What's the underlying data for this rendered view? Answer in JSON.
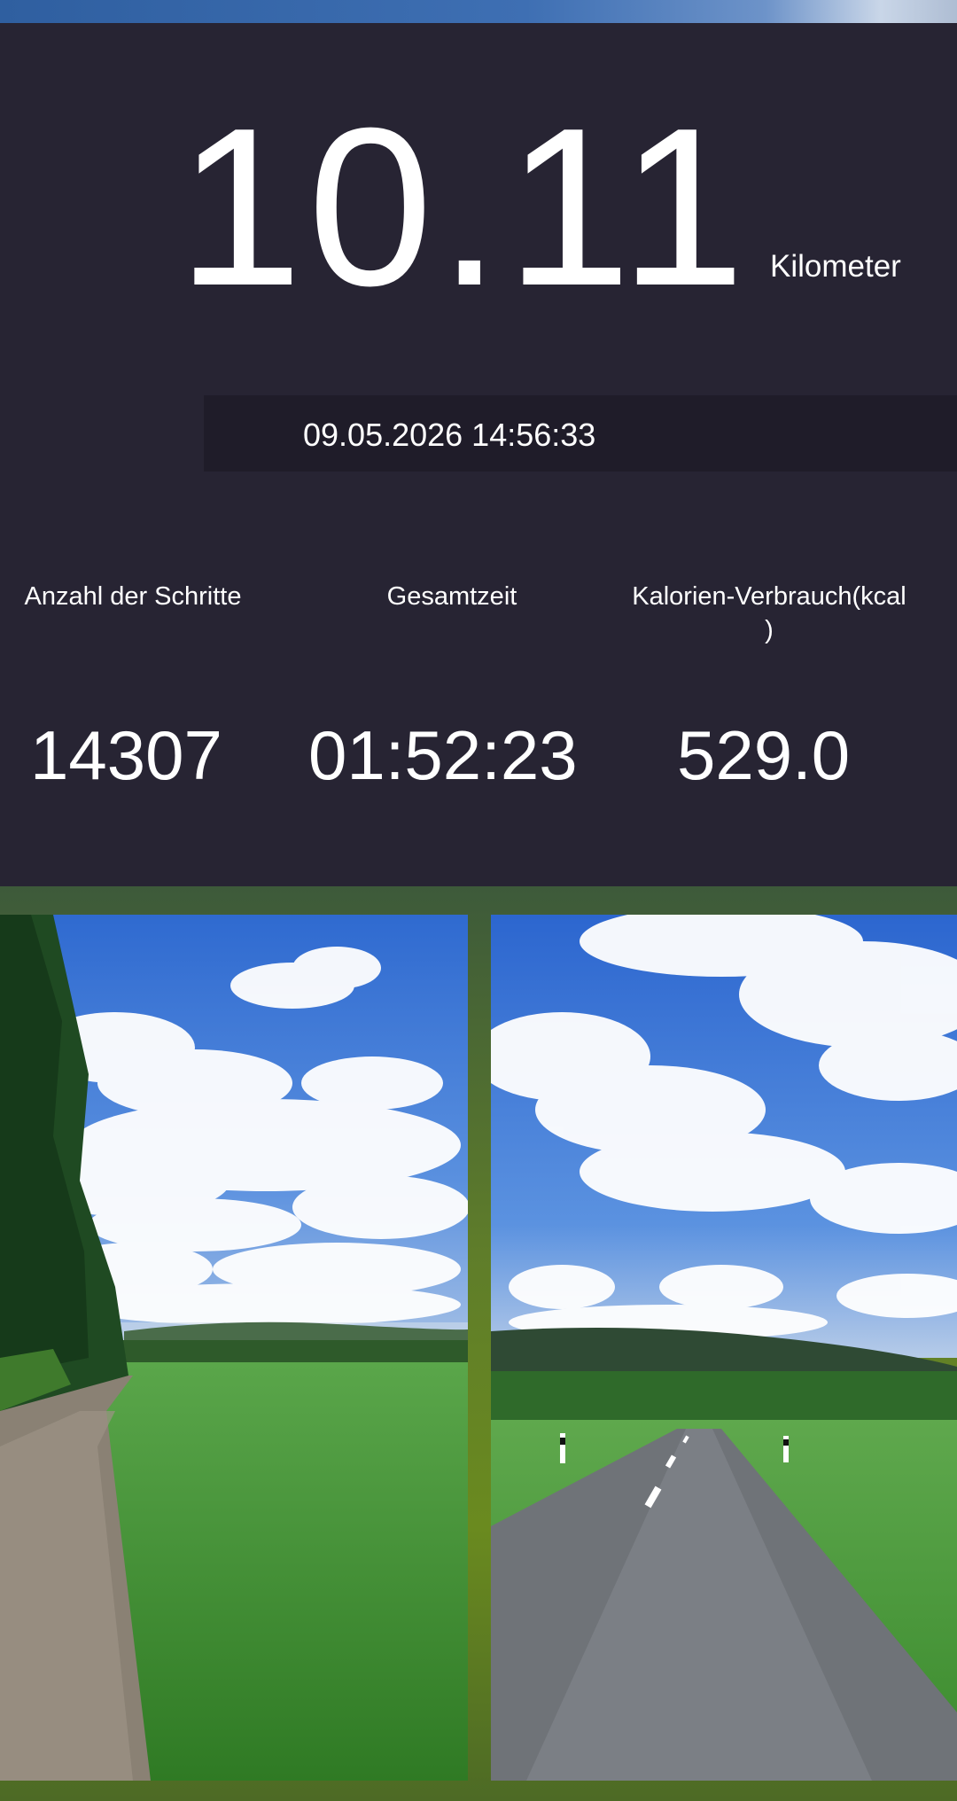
{
  "activity": {
    "distance_value": "10.11",
    "distance_unit": "Kilometer",
    "datetime": "09.05.2026 14:56:33"
  },
  "metrics": [
    {
      "label": "Anzahl der Schritte",
      "value": "14307"
    },
    {
      "label": "Gesamtzeit",
      "value": "01:52:23"
    },
    {
      "label": "Kalorien-Verbrauch(kcal\n)",
      "value": "529.0"
    }
  ],
  "photos": [
    {
      "subject": "gravel path beside green field and forest under blue sky with clouds"
    },
    {
      "subject": "paved country road through green fields under blue sky with clouds"
    }
  ],
  "colors": {
    "panel_background": "#272433",
    "datetime_bar": "#1f1c29",
    "text": "#ffffff",
    "frame_green": "#5f7d2a"
  }
}
